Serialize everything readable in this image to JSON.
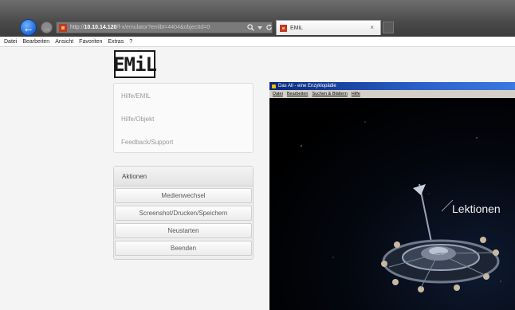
{
  "browser": {
    "address": {
      "url_prefix": "http://",
      "url_host": "10.10.14.120",
      "url_rest": "/f-x/emulator?emlbt=4404&objectId=0",
      "search_icon": "search-icon",
      "refresh_icon": "refresh-icon"
    },
    "tab": {
      "title": "EMiL",
      "close_glyph": "×"
    },
    "back_glyph": "←",
    "forward_glyph": "→",
    "menubar": [
      "Datei",
      "Bearbeiten",
      "Ansicht",
      "Favoriten",
      "Extras",
      "?"
    ]
  },
  "page": {
    "logo_text": "EMiL",
    "help_links": [
      "Hilfe/EMIL",
      "Hilfe/Objekt",
      "Feedback/Support"
    ],
    "actions": {
      "header": "Aktionen",
      "buttons": [
        "Medienwechsel",
        "Screenshot/Drucken/Speichern",
        "Neustarten",
        "Beenden"
      ]
    }
  },
  "emulator": {
    "window_title": "Das All - eine Enzyklopädie",
    "menubar": [
      "Datei",
      "Bearbeiten",
      "Suchen & Blättern",
      "Hilfe"
    ],
    "screen_text": "Lektionen"
  },
  "colors": {
    "accent_blue": "#1e67d6",
    "emulator_title": "#0a2a7a",
    "background": "#f4f4f4"
  }
}
